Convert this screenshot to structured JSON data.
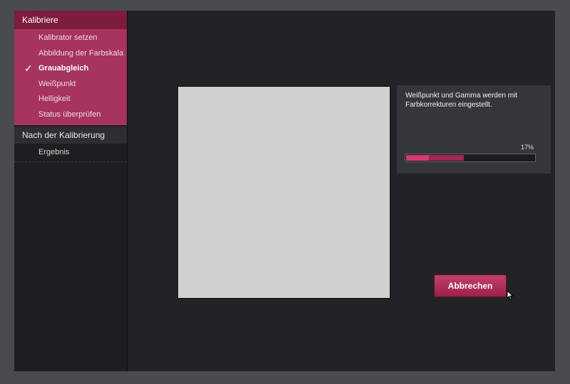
{
  "sidebar": {
    "sections": [
      {
        "title": "Kalibriere",
        "items": [
          {
            "label": "Kalibrator setzen",
            "active": false
          },
          {
            "label": "Abbildung der Farbskala",
            "active": false
          },
          {
            "label": "Grauabgleich",
            "active": true
          },
          {
            "label": "Weißpunkt",
            "active": false
          },
          {
            "label": "Helligkeit",
            "active": false
          },
          {
            "label": "Status überprüfen",
            "active": false
          }
        ]
      },
      {
        "title": "Nach der Kalibrierung",
        "items": [
          {
            "label": "Ergebnis",
            "active": false
          }
        ]
      }
    ],
    "active_marker_icon": "checkmark-icon"
  },
  "status": {
    "message": "Weißpunkt und Gamma werden mit Farbkorrekturen eingestellt.",
    "progress_label": "17%",
    "progress_fraction": 0.45
  },
  "preview": {
    "color": "#d0d0d0"
  },
  "actions": {
    "cancel_label": "Abbrechen"
  },
  "colors": {
    "accent": "#a6345e",
    "accent_dark": "#7d1c3e",
    "background": "#212327"
  }
}
